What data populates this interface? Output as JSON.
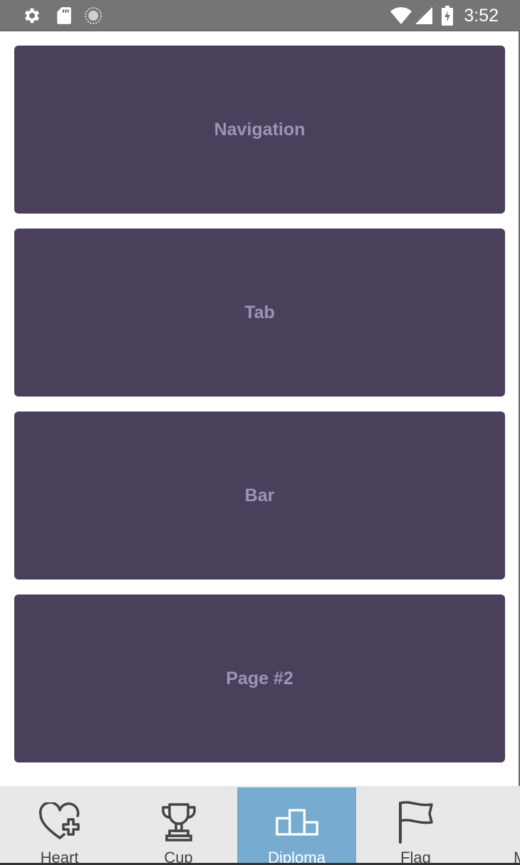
{
  "status_bar": {
    "time": "3:52",
    "icons": [
      "gear-icon",
      "sd-card-icon",
      "sync-circle-icon",
      "wifi-icon",
      "signal-icon",
      "battery-charging-icon"
    ]
  },
  "cards": [
    {
      "label": "Navigation"
    },
    {
      "label": "Tab"
    },
    {
      "label": "Bar"
    },
    {
      "label": "Page #2"
    }
  ],
  "tab_bar": {
    "active_index": 2,
    "active_color": "#77acd0",
    "tabs": [
      {
        "label": "Heart",
        "icon": "heart-plus-icon"
      },
      {
        "label": "Cup",
        "icon": "trophy-icon"
      },
      {
        "label": "Diploma",
        "icon": "podium-icon"
      },
      {
        "label": "Flag",
        "icon": "flag-icon"
      },
      {
        "label": "M",
        "icon": "more-icon"
      }
    ]
  },
  "colors": {
    "status_bar": "#757575",
    "card_background": "#4a405c",
    "card_text": "#9e92b6",
    "tab_bar_background": "#e8e8e8"
  }
}
